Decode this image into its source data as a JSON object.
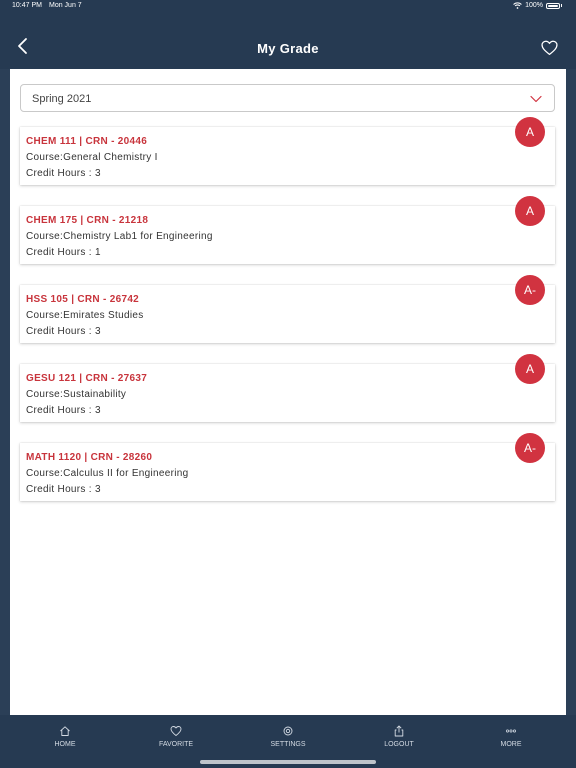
{
  "status_bar": {
    "time": "10:47 PM",
    "date": "Mon Jun 7",
    "battery": "100%"
  },
  "header": {
    "title": "My Grade",
    "back_icon": "chevron-left-icon",
    "favorite_icon": "heart-icon"
  },
  "term_selector": {
    "value": "Spring 2021",
    "icon": "chevron-down-icon"
  },
  "courses": [
    {
      "code": "CHEM 111 | CRN - 20446",
      "course": "Course:General Chemistry I",
      "hours": "Credit Hours : 3",
      "grade": "A"
    },
    {
      "code": "CHEM 175 | CRN - 21218",
      "course": "Course:Chemistry Lab1 for Engineering",
      "hours": "Credit Hours : 1",
      "grade": "A"
    },
    {
      "code": "HSS 105 | CRN - 26742",
      "course": "Course:Emirates Studies",
      "hours": "Credit Hours : 3",
      "grade": "A-"
    },
    {
      "code": "GESU 121 | CRN - 27637",
      "course": "Course:Sustainability",
      "hours": "Credit Hours : 3",
      "grade": "A"
    },
    {
      "code": "MATH 1120 | CRN - 28260",
      "course": "Course:Calculus II for Engineering",
      "hours": "Credit Hours : 3",
      "grade": "A-"
    }
  ],
  "tabs": [
    {
      "label": "HOME",
      "icon": "home-icon"
    },
    {
      "label": "FAVORITE",
      "icon": "heart-icon"
    },
    {
      "label": "SETTINGS",
      "icon": "gear-icon"
    },
    {
      "label": "LOGOUT",
      "icon": "share-icon"
    },
    {
      "label": "MORE",
      "icon": "more-icon"
    }
  ],
  "colors": {
    "header": "#263a52",
    "accent_red": "#d13340",
    "code_red": "#c8343c"
  }
}
